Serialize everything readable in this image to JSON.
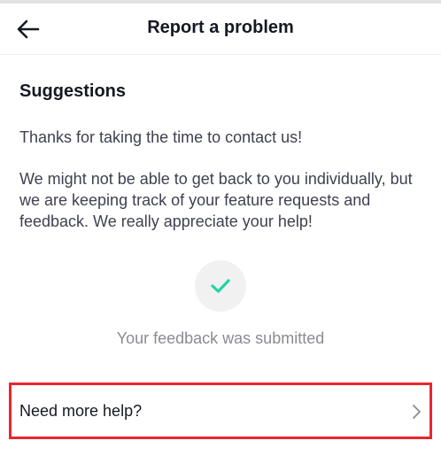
{
  "header": {
    "title": "Report a problem",
    "back_icon": "arrow-left-icon"
  },
  "content": {
    "section_title": "Suggestions",
    "paragraph_1": "Thanks for taking the time to contact us!",
    "paragraph_2": "We might not be able to get back to you individually, but we are keeping track of your feature requests and feedback. We really appreciate your help!",
    "status_icon": "checkmark-icon",
    "status_text": "Your feedback was submitted"
  },
  "help": {
    "label": "Need more help?",
    "icon": "chevron-right-icon"
  },
  "colors": {
    "accent": "#20d5a0",
    "highlight_border": "#e8262e",
    "text_primary": "#161823",
    "text_secondary": "#3f4150",
    "text_muted": "#8a8b91"
  }
}
